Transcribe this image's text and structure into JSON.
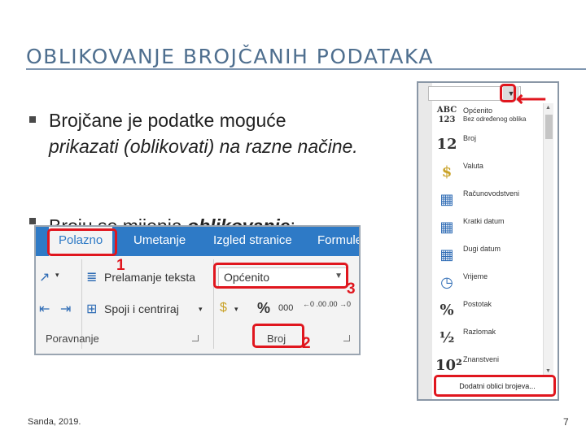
{
  "slide": {
    "title": "OBLIKOVANJE BROJČANIH PODATAKA",
    "bullet1_start": "Brojčane je podatke moguće",
    "bullet1_italic": "prikazati (oblikovati) na razne načine.",
    "bullet2_start": "Broju se mijenja",
    "bullet2_italic": "oblikovanje",
    "bullet2_end": ":",
    "footer_left": "Sanda, 2019.",
    "page_number": "7"
  },
  "ribbon": {
    "tabs": [
      "Polazno",
      "Umetanje",
      "Izgled stranice",
      "Formule"
    ],
    "wrap_text": "Prelamanje teksta",
    "merge_center": "Spoji i centriraj",
    "format_value": "Općenito",
    "percent": "%",
    "thousands": "000",
    "dec_increase": "←0 .00",
    "dec_decrease": ".00 →0",
    "group_alignment": "Poravnanje",
    "group_number": "Broj"
  },
  "callouts": [
    "1",
    "2",
    "3"
  ],
  "format_panel": {
    "input_value": "",
    "items": [
      {
        "icon": "ABC 123",
        "label": "Općenito",
        "sub": "Bez određenog oblika"
      },
      {
        "icon": "12",
        "label": "Broj",
        "sub": ""
      },
      {
        "icon": "currency-icon",
        "label": "Valuta",
        "sub": ""
      },
      {
        "icon": "accounting-icon",
        "label": "Računovodstveni",
        "sub": ""
      },
      {
        "icon": "calendar-icon",
        "label": "Kratki datum",
        "sub": ""
      },
      {
        "icon": "calendar-icon",
        "label": "Dugi datum",
        "sub": ""
      },
      {
        "icon": "clock-icon",
        "label": "Vrijeme",
        "sub": ""
      },
      {
        "icon": "%",
        "label": "Postotak",
        "sub": ""
      },
      {
        "icon": "½",
        "label": "Razlomak",
        "sub": ""
      },
      {
        "icon": "10²",
        "label": "Znanstveni",
        "sub": ""
      }
    ],
    "more_formats": "Dodatni oblici brojeva..."
  },
  "colors": {
    "title": "#4f6f8f",
    "ribbon_tab_bg": "#2e7ac6",
    "callout_red": "#e0161e"
  }
}
